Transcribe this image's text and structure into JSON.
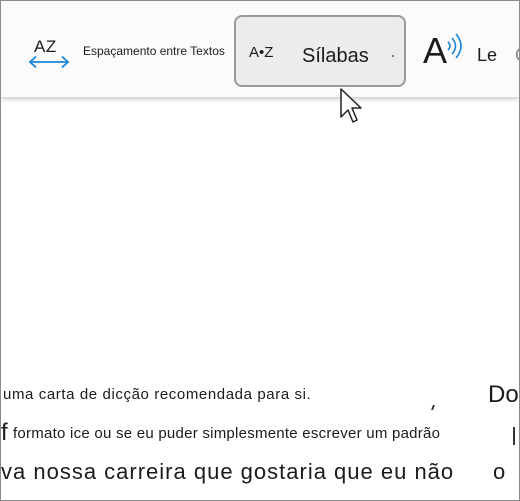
{
  "toolbar": {
    "spacing": {
      "icon_text": "AZ",
      "label": "Espaçamento entre Textos",
      "icon": "text-spacing-icon"
    },
    "syllables": {
      "icon_text": "A•Z",
      "label": "Sílabas",
      "icon": "syllables-icon"
    },
    "read_aloud": {
      "icon_text": "A",
      "label": "Le",
      "clipped": "C",
      "icon": "read-aloud-icon"
    }
  },
  "document": {
    "lines": [
      "uma carta de dicção recomendada para si.",
      "formato ice ou se eu puder simplesmente escrever um padrão",
      "va nossa carreira que gostaria que eu não"
    ],
    "left_fragment": "f",
    "right_fragments": [
      "Do",
      "o"
    ]
  },
  "colors": {
    "accent": "#1a86d8",
    "toolbar_bg": "#fbfbfb",
    "selected_bg": "#ececec"
  }
}
